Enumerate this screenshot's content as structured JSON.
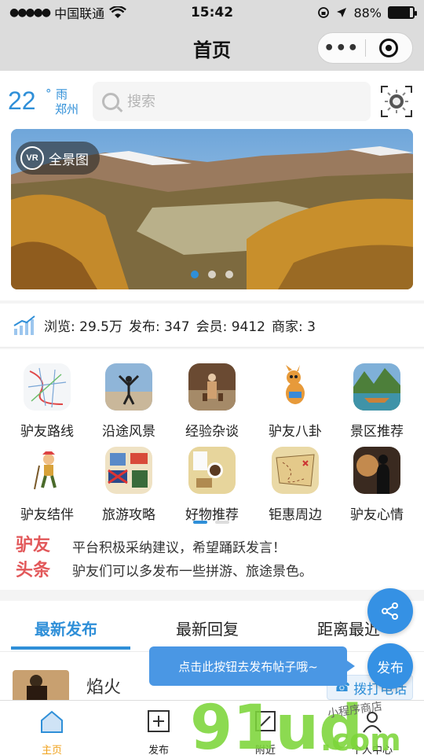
{
  "status_bar": {
    "carrier": "中国联通",
    "time": "15:42",
    "battery": "88%",
    "battery_level": 0.88
  },
  "nav": {
    "title": "首页",
    "more_label": "•••"
  },
  "weather": {
    "temperature": "22",
    "degree": "°",
    "condition": "雨",
    "city": "郑州"
  },
  "search": {
    "placeholder": "搜索"
  },
  "banner": {
    "vr_icon_text": "VR",
    "vr_label": "全景图",
    "slide_count": 3,
    "active_slide": 1
  },
  "stats": {
    "views": "浏览: 29.5万",
    "posts": "发布: 347",
    "members": "会员: 9412",
    "merchants": "商家: 3"
  },
  "categories": [
    {
      "label": "驴友路线",
      "icon": "route-map-icon"
    },
    {
      "label": "沿途风景",
      "icon": "scenery-photo-icon"
    },
    {
      "label": "经验杂谈",
      "icon": "traveler-photo-icon"
    },
    {
      "label": "驴友八卦",
      "icon": "cartoon-kangaroo-icon"
    },
    {
      "label": "景区推荐",
      "icon": "lake-boat-icon"
    },
    {
      "label": "驴友结伴",
      "icon": "cartoon-hiker-icon"
    },
    {
      "label": "旅游攻略",
      "icon": "travel-guide-icon"
    },
    {
      "label": "好物推荐",
      "icon": "coffee-items-icon"
    },
    {
      "label": "钜惠周边",
      "icon": "treasure-map-icon"
    },
    {
      "label": "驴友心情",
      "icon": "sunset-silhouette-icon"
    }
  ],
  "grid_pager": {
    "pages": 2,
    "active": 1
  },
  "headline": {
    "logo_line1": "驴友",
    "logo_line2": "头条",
    "line1": "平台积极采纳建议，希望踊跃发言！",
    "line2": "驴友们可以多发布一些拼游、旅途景色。"
  },
  "tabs": [
    {
      "label": "最新发布",
      "active": true
    },
    {
      "label": "最新回复",
      "active": false
    },
    {
      "label": "距离最近",
      "active": false
    }
  ],
  "post": {
    "title": "焰火",
    "call_label": "拨打电话"
  },
  "fab": {
    "publish_label": "发布",
    "tooltip": "点击此按钮去发布帖子哦~"
  },
  "tabbar": [
    {
      "label": "主页",
      "icon": "home-icon",
      "active": true
    },
    {
      "label": "发布",
      "icon": "plus-square-icon",
      "active": false
    },
    {
      "label": "附近",
      "icon": "nearby-icon",
      "active": false
    },
    {
      "label": "个人中心",
      "icon": "user-icon",
      "active": false
    }
  ],
  "watermark": {
    "text": "91ud",
    "suffix": ".com",
    "tagline": "小程序商店"
  },
  "colors": {
    "accent": "#2f8fd8",
    "headline_red": "#e2585a",
    "active_tab_icon": "#f0a21c",
    "watermark_green": "#7dd63a"
  }
}
